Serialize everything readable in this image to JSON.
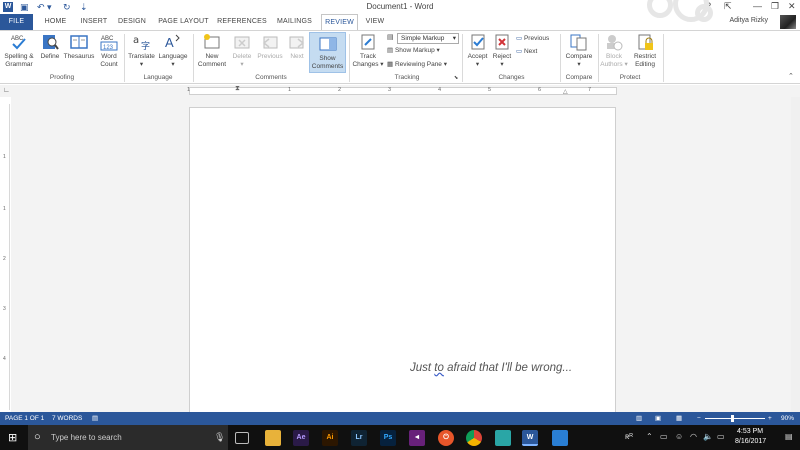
{
  "window": {
    "title": "Document1 - Word",
    "word_logo": "W",
    "help": "?",
    "minimize": "—",
    "restore": "❐",
    "close": "✕",
    "ribbon_display": "⇱"
  },
  "quick_access": {
    "save": "▣",
    "undo": "↶ ▾",
    "redo": "↻",
    "customize": "⇣"
  },
  "tabs": {
    "file": "FILE",
    "home": "HOME",
    "insert": "INSERT",
    "design": "DESIGN",
    "page_layout": "PAGE LAYOUT",
    "references": "REFERENCES",
    "mailings": "MAILINGS",
    "review": "REVIEW",
    "view": "VIEW"
  },
  "user": {
    "name": "Aditya Rizky"
  },
  "ribbon": {
    "proofing": {
      "group": "Proofing",
      "spelling_l1": "Spelling &",
      "spelling_l2": "Grammar",
      "define": "Define",
      "thesaurus": "Thesaurus",
      "wordcount_l1": "Word",
      "wordcount_l2": "Count",
      "abc": "ABC",
      "abc123": "ABC 123"
    },
    "language": {
      "group": "Language",
      "translate": "Translate",
      "language": "Language"
    },
    "comments": {
      "group": "Comments",
      "new_l1": "New",
      "new_l2": "Comment",
      "delete": "Delete",
      "previous": "Previous",
      "next": "Next",
      "show_l1": "Show",
      "show_l2": "Comments"
    },
    "tracking": {
      "group": "Tracking",
      "track_l1": "Track",
      "track_l2": "Changes",
      "simple_markup": "Simple Markup",
      "show_markup": "Show Markup",
      "reviewing_pane": "Reviewing Pane"
    },
    "changes": {
      "group": "Changes",
      "accept": "Accept",
      "reject": "Reject",
      "previous": "Previous",
      "next": "Next"
    },
    "compare": {
      "group": "Compare",
      "compare": "Compare"
    },
    "protect": {
      "group": "Protect",
      "block_l1": "Block",
      "block_l2": "Authors",
      "restrict_l1": "Restrict",
      "restrict_l2": "Editing"
    }
  },
  "ruler": {
    "h": [
      "1",
      "1",
      "2",
      "3",
      "4",
      "5",
      "6",
      "7"
    ],
    "v": [
      "1",
      "1",
      "2",
      "3",
      "4"
    ]
  },
  "document": {
    "text_before": "Just ",
    "text_flagged": "to",
    "text_after": " afraid that I'll be wrong..."
  },
  "status": {
    "page": "PAGE 1 OF 1",
    "words": "7 WORDS",
    "zoom": "90%",
    "minus": "−",
    "plus": "+"
  },
  "taskbar": {
    "search_placeholder": "Type here to search",
    "time": "4:53 PM",
    "date": "8/16/2017",
    "apps": [
      "Ae",
      "Ai",
      "Lr",
      "Ps"
    ]
  },
  "colors": {
    "accent": "#2b579a",
    "taskbar": "#101010"
  }
}
